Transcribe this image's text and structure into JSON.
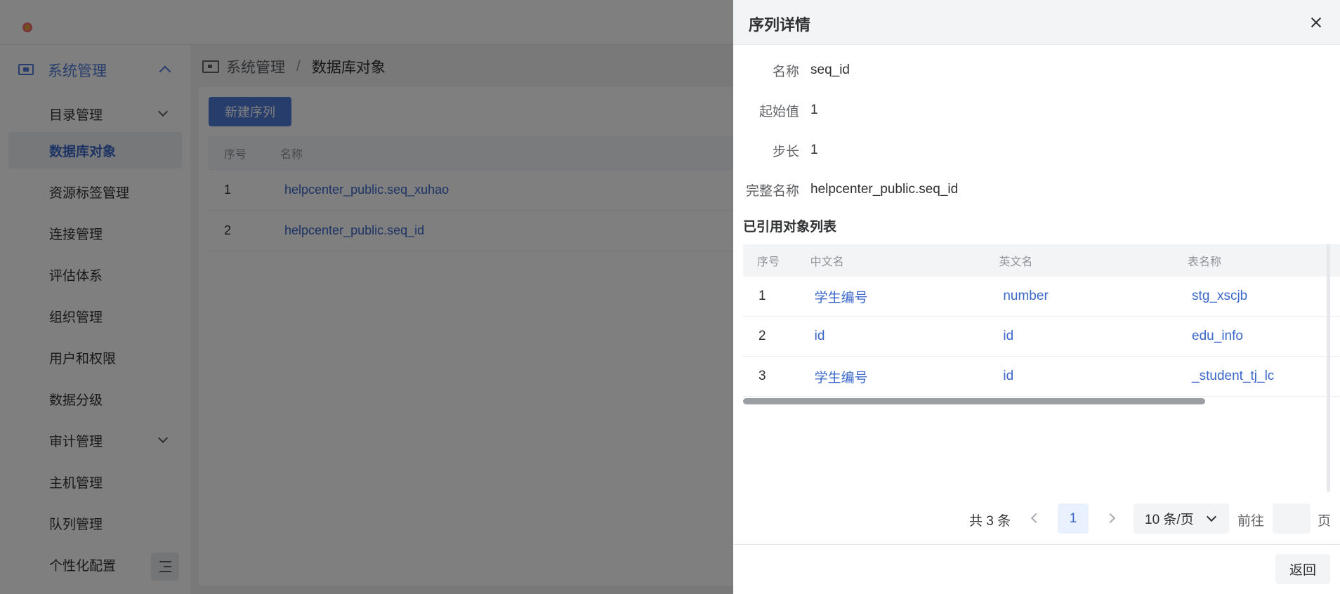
{
  "sidebar": {
    "group_label": "系统管理",
    "items": [
      {
        "label": "目录管理"
      },
      {
        "label": "数据库对象"
      },
      {
        "label": "资源标签管理"
      },
      {
        "label": "连接管理"
      },
      {
        "label": "评估体系"
      },
      {
        "label": "组织管理"
      },
      {
        "label": "用户和权限"
      },
      {
        "label": "数据分级"
      },
      {
        "label": "审计管理"
      },
      {
        "label": "主机管理"
      },
      {
        "label": "队列管理"
      },
      {
        "label": "个性化配置"
      }
    ]
  },
  "breadcrumb": {
    "root": "系统管理",
    "separator": "/",
    "current": "数据库对象"
  },
  "main": {
    "new_button": "新建序列",
    "table": {
      "headers": [
        "序号",
        "名称"
      ],
      "rows": [
        {
          "idx": "1",
          "name": "helpcenter_public.seq_xuhao"
        },
        {
          "idx": "2",
          "name": "helpcenter_public.seq_id"
        }
      ]
    }
  },
  "drawer": {
    "title": "序列详情",
    "fields": {
      "name_label": "名称",
      "name_value": "seq_id",
      "start_label": "起始值",
      "start_value": "1",
      "step_label": "步长",
      "step_value": "1",
      "fullname_label": "完整名称",
      "fullname_value": "helpcenter_public.seq_id"
    },
    "ref_title": "已引用对象列表",
    "ref_table": {
      "headers": [
        "序号",
        "中文名",
        "英文名",
        "表名称"
      ],
      "rows": [
        [
          "1",
          "学生编号",
          "number",
          "stg_xscjb"
        ],
        [
          "2",
          "id",
          "id",
          "edu_info"
        ],
        [
          "3",
          "学生编号",
          "id",
          "_student_tj_lc"
        ]
      ]
    },
    "pagination": {
      "total": "共 3 条",
      "current_page": "1",
      "page_size": "10 条/页",
      "goto_label": "前往",
      "page_suffix": "页"
    },
    "back_button": "返回"
  },
  "colors": {
    "accent": "#4e7bd9",
    "link": "#3a67c9",
    "mask": "rgba(0,0,0,0.5)"
  }
}
